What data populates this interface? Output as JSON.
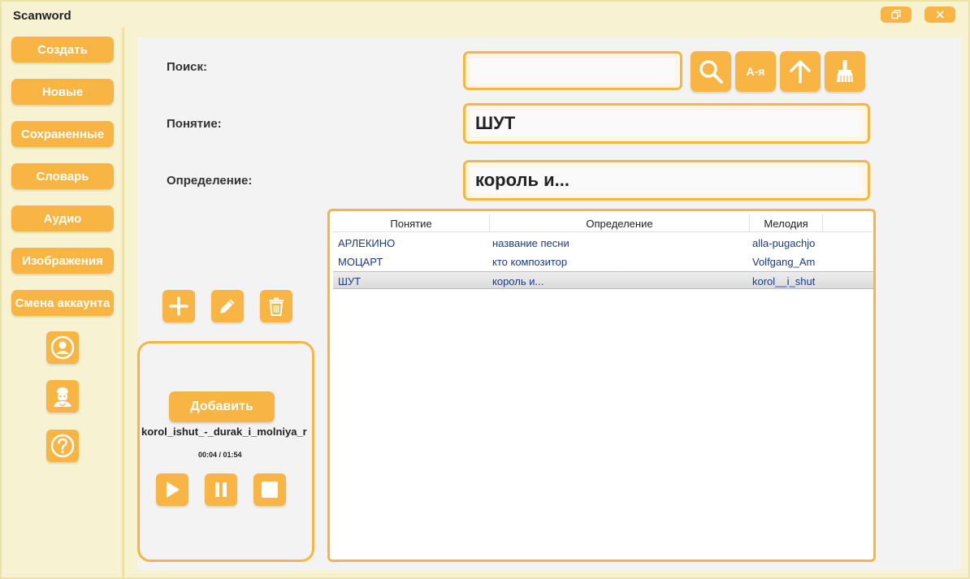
{
  "window": {
    "title": "Scanword"
  },
  "sidebar": {
    "items": [
      {
        "label": "Создать"
      },
      {
        "label": "Новые"
      },
      {
        "label": "Сохраненные"
      },
      {
        "label": "Словарь"
      },
      {
        "label": "Аудио"
      },
      {
        "label": "Изображения"
      },
      {
        "label": "Смена аккаунта"
      }
    ],
    "icons": [
      "user-icon",
      "admin-icon",
      "help-icon"
    ]
  },
  "form": {
    "search_label": "Поиск:",
    "search_value": "",
    "concept_label": "Понятие:",
    "concept_value": "ШУТ",
    "definition_label": "Определение:",
    "definition_value": "король и..."
  },
  "toolbar": {
    "search_icon": "search-icon",
    "sort_label": "А-я",
    "up_icon": "arrow-up-icon",
    "clear_icon": "broom-icon"
  },
  "actions": {
    "add_icon": "plus-icon",
    "edit_icon": "pencil-icon",
    "delete_icon": "trash-icon"
  },
  "audio": {
    "add_label": "Добавить",
    "track_name": "korol_ishut_-_durak_i_molniya_r",
    "time": "00:04 / 01:54",
    "controls": [
      "play-icon",
      "pause-icon",
      "stop-icon"
    ]
  },
  "table": {
    "columns": [
      "Понятие",
      "Определение",
      "Мелодия"
    ],
    "rows": [
      {
        "concept": "АРЛЕКИНО",
        "definition": "название песни",
        "melody": "alla-pugachjo"
      },
      {
        "concept": "МОЦАРТ",
        "definition": "кто композитор",
        "melody": "Volfgang_Am"
      },
      {
        "concept": "ШУТ",
        "definition": "король и...",
        "melody": "korol__i_shut",
        "selected": true
      }
    ]
  },
  "colors": {
    "accent": "#f9b544",
    "sidebar_bg": "#f7f2d2",
    "main_bg": "#f3f3f3",
    "link_text": "#1a3a8a"
  }
}
